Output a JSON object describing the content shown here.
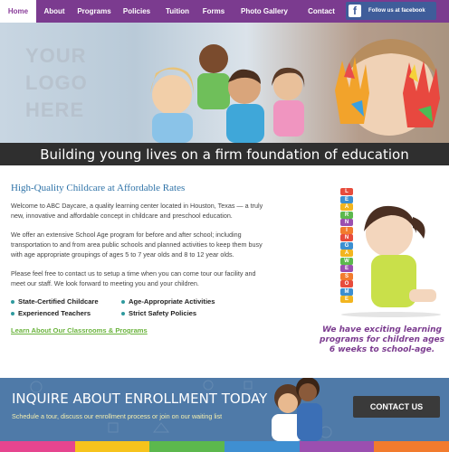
{
  "nav": {
    "items": [
      "Home",
      "About",
      "Programs",
      "Policies",
      "Tuition",
      "Forms",
      "Photo Gallery",
      "Contact"
    ],
    "active_index": 0,
    "facebook_label": "Follow us at facebook",
    "facebook_glyph": "f"
  },
  "hero": {
    "logo_line1": "YOUR",
    "logo_line2": "LOGO",
    "logo_line3": "HERE",
    "caption": "Building young lives on a firm foundation of education"
  },
  "content": {
    "heading": "High-Quality Childcare at Affordable Rates",
    "para1": "Welcome to ABC Daycare, a quality learning center located in Houston, Texas — a truly new, innovative and affordable concept in childcare and preschool education.",
    "para2": "We offer an extensive School Age program for before and after school; including transportation to and from area public schools and planned activities to keep them busy with age appropriate groupings of ages 5 to 7 year olds and 8 to 12 year olds.",
    "para3": "Please feel free to contact us to setup a time when you can come tour our facility and meet our staff. We look forward to meeting you and your children.",
    "features": [
      "State-Certified Childcare",
      "Age-Appropriate Activities",
      "Experienced Teachers",
      "Strict Safety Policies"
    ],
    "learn_link": "Learn About Our Classrooms & Programs"
  },
  "right_panel": {
    "caption_line1": "We have exciting learning",
    "caption_line2": "programs for children ages",
    "caption_line3": "6 weeks to school-age.",
    "blocks": [
      "L",
      "E",
      "A",
      "R",
      "N",
      "I",
      "N",
      "G",
      "A",
      "W",
      "E",
      "S",
      "O",
      "M",
      "E"
    ]
  },
  "enroll": {
    "title": "INQUIRE ABOUT ENROLLMENT TODAY",
    "subtitle": "Schedule a tour, discuss our enrollment process or join on our waiting list",
    "button": "CONTACT US"
  },
  "colors": {
    "nav_bg": "#7b3b8f",
    "accent_blue": "#2f73a8",
    "accent_green": "#6ab33c",
    "enroll_bg": "#4f7aa8",
    "stripe": [
      "#e6458f",
      "#f6c31c",
      "#5cb84d",
      "#3f8fd1",
      "#9b4fb0",
      "#f27b2d"
    ]
  }
}
